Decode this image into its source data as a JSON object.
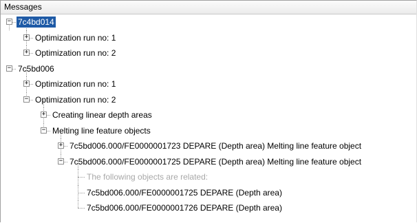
{
  "panel": {
    "header": "Messages"
  },
  "tree": [
    {
      "label": "7c4bd014",
      "depth": 0,
      "expander": "minus",
      "selected": true
    },
    {
      "label": "Optimization run no: 1",
      "depth": 1,
      "expander": "plus"
    },
    {
      "label": "Optimization run no: 2",
      "depth": 1,
      "expander": "plus"
    },
    {
      "label": "7c5bd006",
      "depth": 0,
      "expander": "minus"
    },
    {
      "label": "Optimization run no: 1",
      "depth": 1,
      "expander": "plus"
    },
    {
      "label": "Optimization run no: 2",
      "depth": 1,
      "expander": "minus"
    },
    {
      "label": "Creating linear depth areas",
      "depth": 2,
      "expander": "plus"
    },
    {
      "label": "Melting line feature objects",
      "depth": 2,
      "expander": "minus"
    },
    {
      "label": "7c5bd006.000/FE0000001723 DEPARE (Depth area) Melting line feature object",
      "depth": 3,
      "expander": "plus"
    },
    {
      "label": "7c5bd006.000/FE0000001725 DEPARE (Depth area) Melting line feature object",
      "depth": 3,
      "expander": "minus"
    },
    {
      "label": "The following objects are related:",
      "depth": 4,
      "expander": "none",
      "style": "gray"
    },
    {
      "label": "7c5bd006.000/FE0000001725 DEPARE (Depth area)",
      "depth": 4,
      "expander": "none"
    },
    {
      "label": "7c5bd006.000/FE0000001726 DEPARE (Depth area)",
      "depth": 4,
      "expander": "none"
    }
  ],
  "icons": {
    "expand": "plus-box-icon",
    "collapse": "minus-box-icon"
  },
  "colors": {
    "selection": "#1e5aa6",
    "connector": "#9a9a9a",
    "gray_text": "#a8a8a8"
  }
}
